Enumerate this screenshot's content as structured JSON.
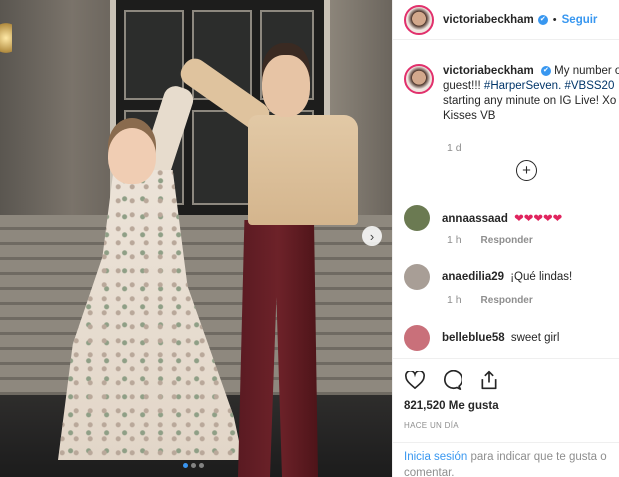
{
  "post": {
    "username": "victoriabeckham",
    "verified_glyph": "✔",
    "separator": "•",
    "follow_label": "Seguir",
    "caption": {
      "username": "victoriabeckham",
      "text_line1": "My number one",
      "text_line2_prefix": "guest!!! ",
      "tag1": "#HarperSeven.",
      "text_line3_tag": "#VBSS20",
      "text_line3": "starting any minute on IG Live! Xo",
      "text_line4": "Kisses VB"
    },
    "caption_time": "1 d",
    "more_comments_glyph": "+",
    "carousel_next_glyph": "›",
    "carousel": {
      "count": 3,
      "active_index": 0
    }
  },
  "comments": [
    {
      "user": "annaassaad",
      "text": "❤❤❤❤❤",
      "time": "1 h",
      "reply": "Responder",
      "avatar_color": "#6b7a52"
    },
    {
      "user": "anaedilia29",
      "text": "¡Qué lindas!",
      "time": "1 h",
      "reply": "Responder",
      "avatar_color": "#a89e96"
    },
    {
      "user": "belleblue58",
      "text": "sweet girl",
      "time": "",
      "reply": "",
      "avatar_color": "#c9707a"
    }
  ],
  "actions": {
    "icons": [
      "heart-icon",
      "comment-icon",
      "share-icon"
    ],
    "likes": "821,520 Me gusta",
    "time_ago": "HACE UN DÍA"
  },
  "login": {
    "link": "Inicia sesión",
    "text": " para indicar que te gusta o comentar."
  }
}
